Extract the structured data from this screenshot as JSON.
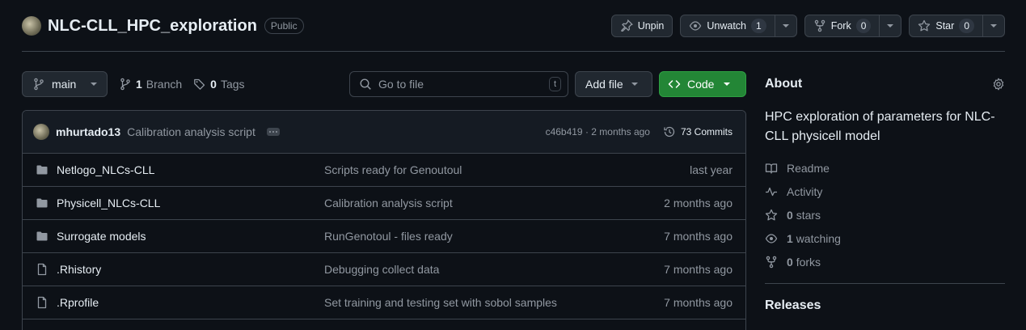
{
  "repo": {
    "name": "NLC-CLL_HPC_exploration",
    "visibility": "Public"
  },
  "header_actions": {
    "unpin_label": "Unpin",
    "unwatch_label": "Unwatch",
    "unwatch_count": "1",
    "fork_label": "Fork",
    "fork_count": "0",
    "star_label": "Star",
    "star_count": "0"
  },
  "toolbar": {
    "branch": "main",
    "branch_count": "1",
    "branch_label": "Branch",
    "tag_count": "0",
    "tag_label": "Tags",
    "search_placeholder": "Go to file",
    "search_shortcut": "t",
    "add_file_label": "Add file",
    "code_label": "Code"
  },
  "latest_commit": {
    "author": "mhurtado13",
    "message": "Calibration analysis script",
    "meta": "c46b419 · 2 months ago",
    "commits_label": "73 Commits"
  },
  "files": [
    {
      "type": "folder",
      "name": "Netlogo_NLCs-CLL",
      "message": "Scripts ready for Genoutoul",
      "date": "last year"
    },
    {
      "type": "folder",
      "name": "Physicell_NLCs-CLL",
      "message": "Calibration analysis script",
      "date": "2 months ago"
    },
    {
      "type": "folder",
      "name": "Surrogate models",
      "message": "RunGenotoul - files ready",
      "date": "7 months ago"
    },
    {
      "type": "file",
      "name": ".Rhistory",
      "message": "Debugging collect data",
      "date": "7 months ago"
    },
    {
      "type": "file",
      "name": ".Rprofile",
      "message": "Set training and testing set with sobol samples",
      "date": "7 months ago"
    }
  ],
  "about": {
    "title": "About",
    "description": "HPC exploration of parameters for NLC-CLL physicell model",
    "readme_label": "Readme",
    "activity_label": "Activity",
    "stars_count": "0",
    "stars_label": "stars",
    "watching_count": "1",
    "watching_label": "watching",
    "forks_count": "0",
    "forks_label": "forks"
  },
  "releases": {
    "title": "Releases"
  },
  "colors": {
    "accent_green": "#238636",
    "background": "#0d1117",
    "border": "#3d444d"
  }
}
